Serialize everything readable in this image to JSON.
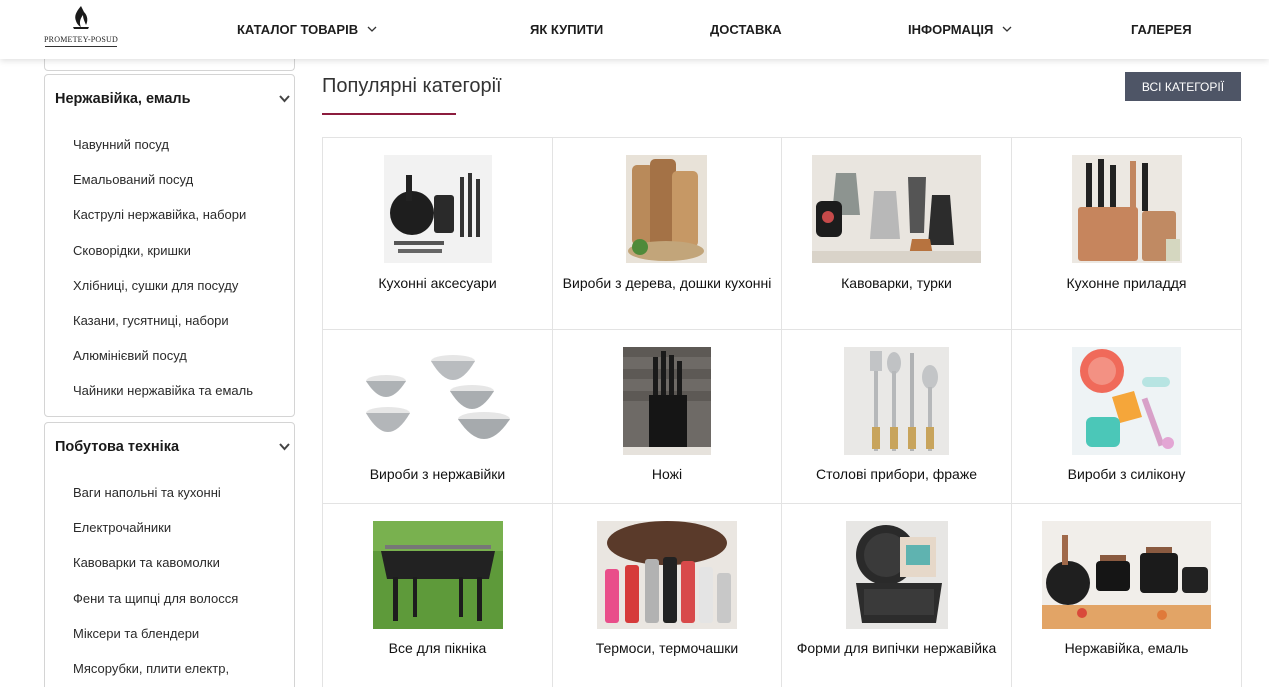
{
  "header": {
    "logo_text": "PROMETEY-POSUD",
    "nav": [
      {
        "label": "КАТАЛОГ ТОВАРІВ",
        "has_dropdown": true
      },
      {
        "label": "ЯК КУПИТИ",
        "has_dropdown": false
      },
      {
        "label": "ДОСТАВКА",
        "has_dropdown": false
      },
      {
        "label": "ІНФОРМАЦІЯ",
        "has_dropdown": true
      },
      {
        "label": "ГАЛЕРЕЯ",
        "has_dropdown": false
      }
    ]
  },
  "sidebar": {
    "groups": [
      {
        "title": "Нержавійка, емаль",
        "items": [
          "Чавунний посуд",
          "Емальований посуд",
          "Каструлі нержавійка, набори",
          "Сковорідки, кришки",
          "Хлібниці, сушки для посуду",
          "Казани, гусятниці, набори",
          "Алюмінієвий посуд",
          "Чайники нержавійка та емаль"
        ]
      },
      {
        "title": "Побутова техніка",
        "items": [
          "Ваги напольні та кухонні",
          "Електрочайники",
          "Кавоварки та кавомолки",
          "Фени та щипці для волосся",
          "Міксери та блендери",
          "Мясорубки, плити електр,"
        ]
      }
    ]
  },
  "main": {
    "title": "Популярні категорії",
    "all_button": "ВСІ КАТЕГОРІЇ",
    "categories": [
      {
        "label": "Кухонні аксесуари",
        "image": "kitchen-accessories-image"
      },
      {
        "label": "Вироби з дерева, дошки кухонні",
        "image": "wooden-boards-image"
      },
      {
        "label": "Кавоварки, турки",
        "image": "coffee-makers-image"
      },
      {
        "label": "Кухонне приладдя",
        "image": "kitchen-utensils-image"
      },
      {
        "label": "Вироби з нержавійки",
        "image": "stainless-bowls-image"
      },
      {
        "label": "Ножі",
        "image": "knives-image"
      },
      {
        "label": "Столові прибори, фраже",
        "image": "cutlery-image"
      },
      {
        "label": "Вироби з силікону",
        "image": "silicone-image"
      },
      {
        "label": "Все для пікніка",
        "image": "grill-image"
      },
      {
        "label": "Термоси, термочашки",
        "image": "thermos-image"
      },
      {
        "label": "Форми для випічки нержавійка",
        "image": "baking-forms-image"
      },
      {
        "label": "Нержавійка, емаль",
        "image": "cookware-set-image"
      }
    ]
  },
  "colors": {
    "accent_underline": "#8c1c3e",
    "button_bg": "#4e5566",
    "border": "#d4d4d4"
  }
}
